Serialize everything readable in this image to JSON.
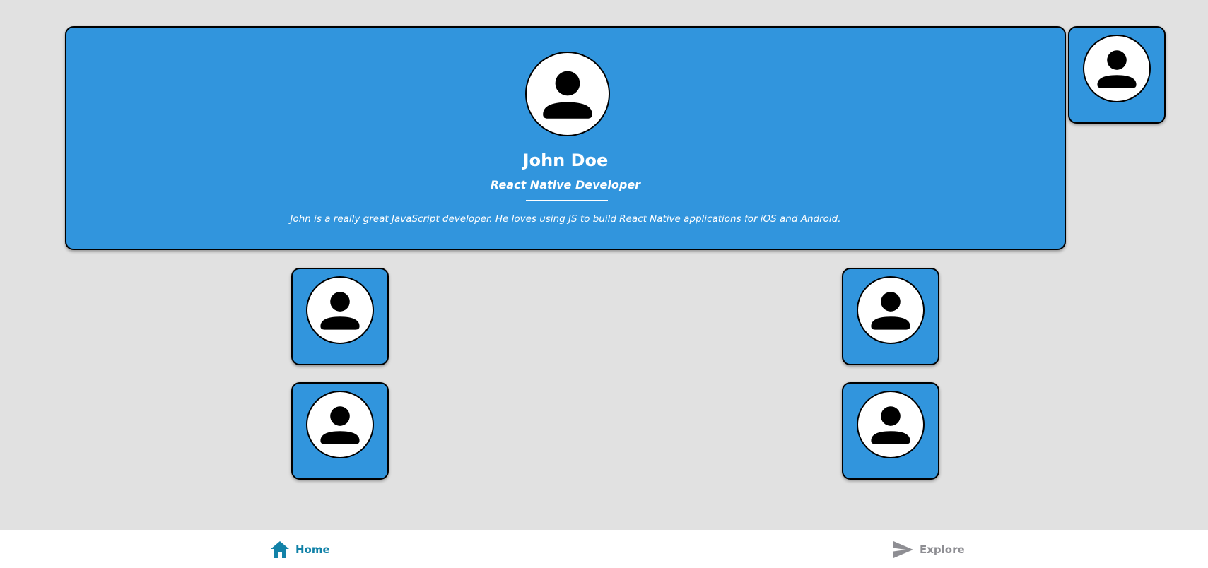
{
  "profile": {
    "name": "John Doe",
    "role": "React Native Developer",
    "bio": "John is a really great JavaScript developer. He loves using JS to build React Native applications for iOS and Android.",
    "avatar_icon": "person-icon"
  },
  "mini_cards": [
    {
      "avatar_icon": "person-icon"
    },
    {
      "avatar_icon": "person-icon"
    },
    {
      "avatar_icon": "person-icon"
    },
    {
      "avatar_icon": "person-icon"
    },
    {
      "avatar_icon": "person-icon"
    }
  ],
  "tabs": [
    {
      "label": "Home",
      "icon": "home-icon",
      "active": true
    },
    {
      "label": "Explore",
      "icon": "send-icon",
      "active": false
    }
  ],
  "colors": {
    "background": "#e1e1e1",
    "card": "#3195dd",
    "tab_active": "#1282a8",
    "tab_inactive": "#8e8e93"
  }
}
